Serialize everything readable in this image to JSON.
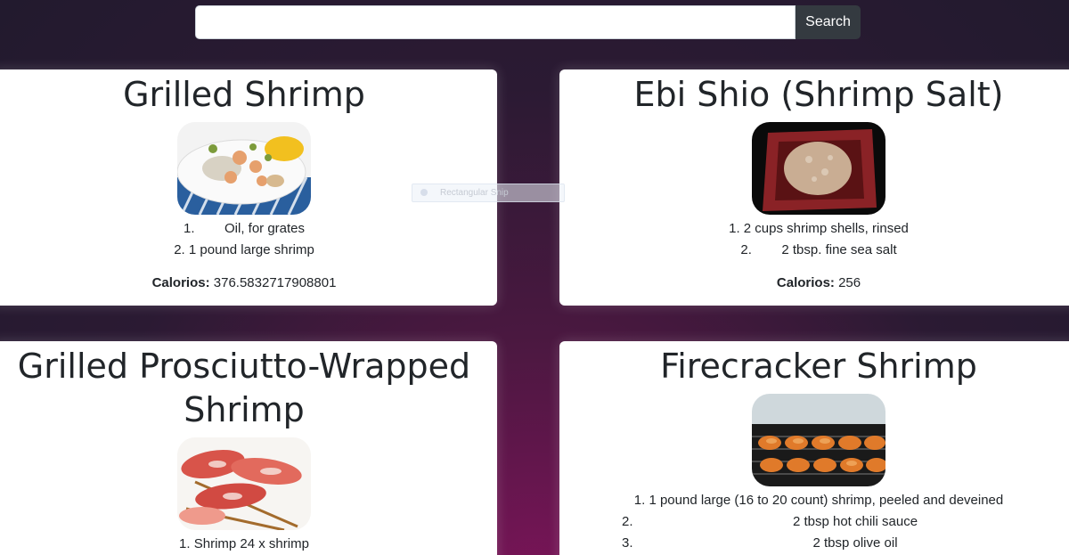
{
  "search": {
    "placeholder": "",
    "value": "",
    "button_label": "Search"
  },
  "recipes": [
    {
      "title": "Grilled Shrimp",
      "image": "grilled-shrimp-corn-plate",
      "ingredients": [
        {
          "num": "1.",
          "text": "Oil, for grates"
        },
        {
          "num": "2.",
          "text": "1 pound large shrimp"
        }
      ],
      "calories_label": "Calorios:",
      "calories_value": "376.5832717908801"
    },
    {
      "title": "Ebi Shio (Shrimp Salt)",
      "image": "shrimp-salt-dish",
      "ingredients": [
        {
          "num": "1.",
          "text": "2 cups shrimp shells, rinsed"
        },
        {
          "num": "2.",
          "text": "2 tbsp. fine sea salt"
        }
      ],
      "calories_label": "Calorios:",
      "calories_value": "256"
    },
    {
      "title": "Grilled Prosciutto-Wrapped Shrimp",
      "image": "prosciutto-wrapped-shrimp-skewers",
      "ingredients": [
        {
          "num": "1.",
          "text": "Shrimp 24 x shrimp"
        }
      ]
    },
    {
      "title": "Firecracker Shrimp",
      "image": "grilled-shrimp-skewers",
      "ingredients": [
        {
          "num": "1.",
          "text": "1 pound large (16 to 20 count) shrimp, peeled and deveined"
        },
        {
          "num": "2.",
          "text": "2 tbsp hot chili sauce"
        },
        {
          "num": "3.",
          "text": "2 tbsp olive oil"
        }
      ]
    }
  ],
  "overlay": {
    "snip_label": "Rectangular Snip"
  }
}
